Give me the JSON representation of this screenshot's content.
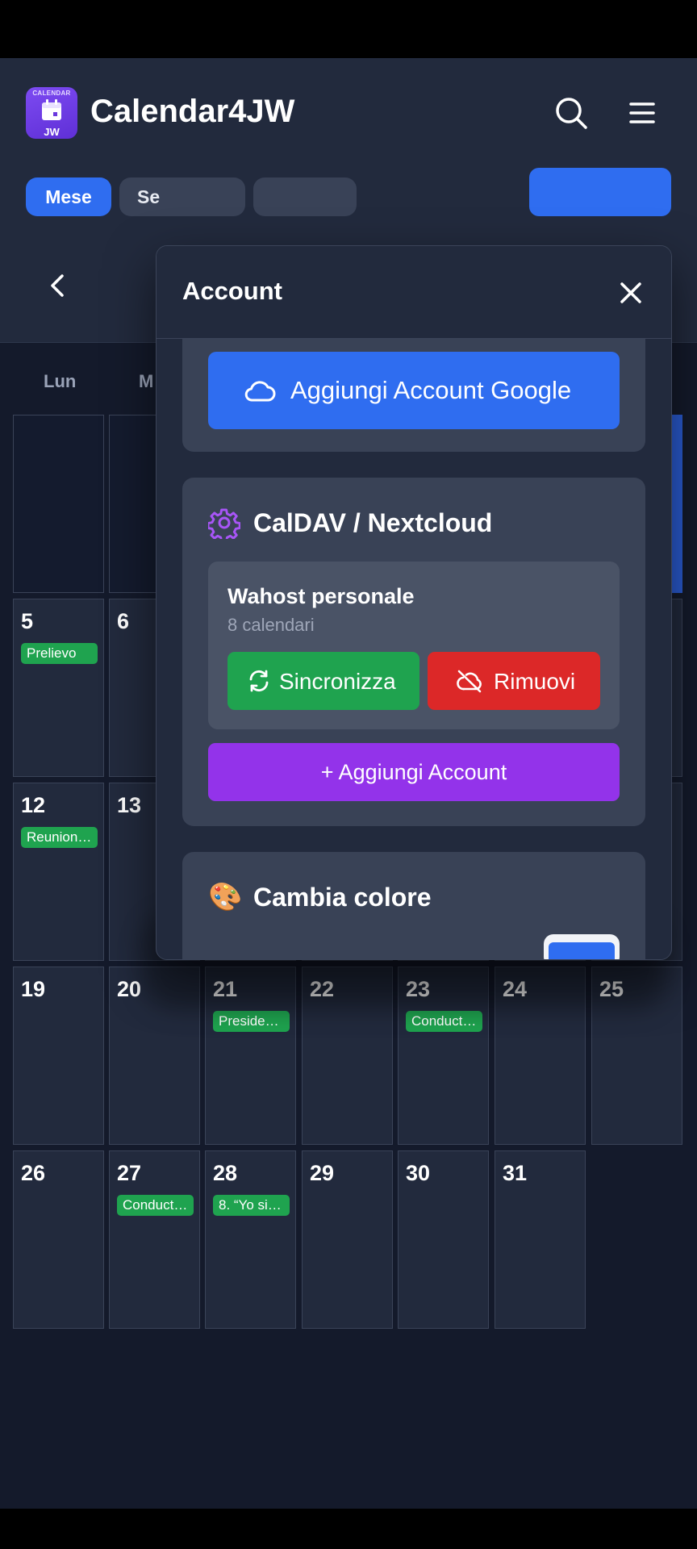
{
  "app": {
    "title": "Calendar4JW",
    "logo_top": "CALENDAR",
    "logo_bottom": "JW"
  },
  "view_tabs": {
    "month": "Mese",
    "week_partial": "Se"
  },
  "weekdays": {
    "mon": "Lun",
    "tue_partial": "M"
  },
  "calendar": {
    "row1": {
      "mon": "5",
      "mon_event": "Prelievo",
      "tue": "6"
    },
    "row2": {
      "mon": "12",
      "mon_event": "Reunion…",
      "tue": "13"
    },
    "row3": {
      "mon": "19",
      "tue": "20",
      "wed": "21",
      "wed_event": "Preside…",
      "thu": "22",
      "fri": "23",
      "fri_event": "Conduct…",
      "sat": "24",
      "sun": "25"
    },
    "row4": {
      "mon": "26",
      "tue": "27",
      "tue_event": "Conduct…",
      "wed": "28",
      "wed_event": "8. “Yo si…",
      "thu": "29",
      "fri": "30",
      "sat": "31"
    }
  },
  "modal": {
    "title": "Account",
    "google_button": "Aggiungi Account Google",
    "caldav": {
      "title": "CalDAV / Nextcloud",
      "account_name": "Wahost personale",
      "account_sub": "8 calendari",
      "sync_button": "Sincronizza",
      "remove_button": "Rimuovi",
      "add_button": "+ Aggiungi Account"
    },
    "color": {
      "title": "Cambia colore",
      "icon": "🎨"
    }
  },
  "colors": {
    "accent": "#2f6df0",
    "success": "#1fa34f",
    "danger": "#dc2828",
    "purple": "#9333ea"
  }
}
